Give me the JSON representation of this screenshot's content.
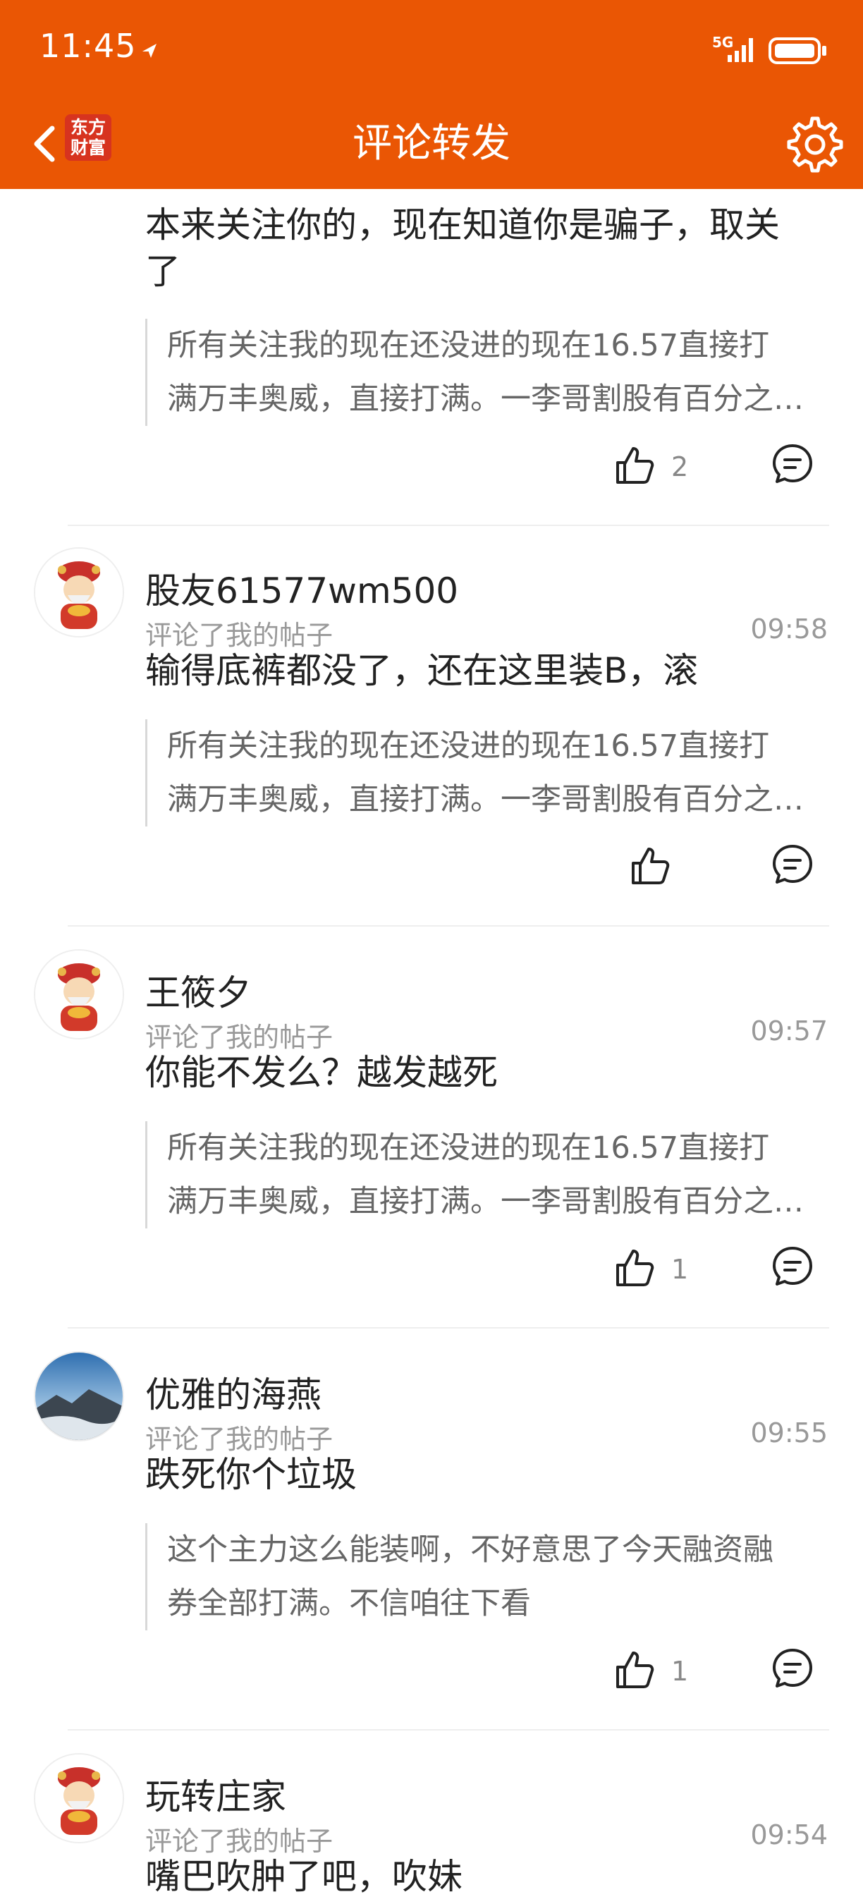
{
  "status_bar": {
    "time": "11:45",
    "network_label": "5G"
  },
  "header": {
    "title": "评论转发",
    "logo_lines": [
      "东方",
      "财富"
    ]
  },
  "colors": {
    "brand": "#ea5604",
    "text": "#222222",
    "muted": "#999999"
  },
  "icons": [
    "back-icon",
    "gear-icon",
    "thumbs-up-icon",
    "comment-icon",
    "signal-icon",
    "battery-icon"
  ],
  "comments": [
    {
      "comment": "本来关注你的，现在知道你是骗子，取关了",
      "comment_lines": [
        "本来关注你的，现在知道你是骗子，取关",
        "了"
      ],
      "quote_lines": [
        "所有关注我的现在还没进的现在16.57直接打",
        "满万丰奥威，直接打满。一李哥割股有百分之…"
      ],
      "likes": "2"
    },
    {
      "username": "股友61577wm500",
      "action": "评论了我的帖子",
      "time": "09:58",
      "comment": "输得底裤都没了，还在这里装B，滚",
      "quote_lines": [
        "所有关注我的现在还没进的现在16.57直接打",
        "满万丰奥威，直接打满。一李哥割股有百分之…"
      ],
      "likes": ""
    },
    {
      "username": "王筱夕",
      "action": "评论了我的帖子",
      "time": "09:57",
      "comment": "你能不发么？越发越死",
      "quote_lines": [
        "所有关注我的现在还没进的现在16.57直接打",
        "满万丰奥威，直接打满。一李哥割股有百分之…"
      ],
      "likes": "1"
    },
    {
      "username": "优雅的海燕",
      "action": "评论了我的帖子",
      "time": "09:55",
      "comment": "跌死你个垃圾",
      "quote_lines": [
        "这个主力这么能装啊，不好意思了今天融资融",
        "券全部打满。不信咱往下看"
      ],
      "likes": "1"
    },
    {
      "username": "玩转庄家",
      "action": "评论了我的帖子",
      "time": "09:54",
      "comment": "嘴巴吹肿了吧，吹妹"
    }
  ]
}
